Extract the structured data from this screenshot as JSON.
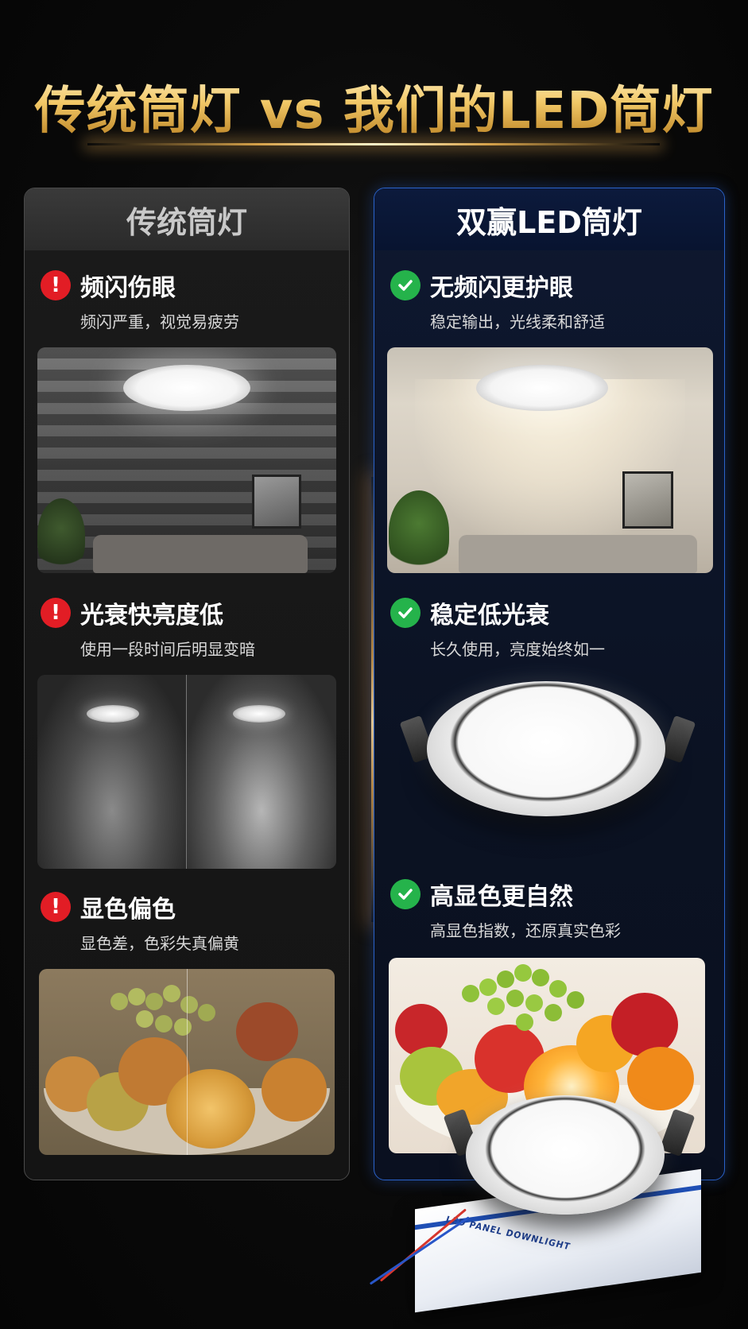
{
  "header": {
    "title": "传统筒灯 vs 我们的LED筒灯"
  },
  "left_panel": {
    "heading": "传统筒灯",
    "features": [
      {
        "icon": "warning-icon",
        "title": "频闪伤眼",
        "subtitle": "频闪严重，视觉易疲劳"
      },
      {
        "icon": "warning-icon",
        "title": "光衰快亮度低",
        "subtitle": "使用一段时间后明显变暗"
      },
      {
        "icon": "warning-icon",
        "title": "显色偏色",
        "subtitle": "显色差，色彩失真偏黄"
      }
    ]
  },
  "right_panel": {
    "heading": "双赢LED筒灯",
    "features": [
      {
        "icon": "check-icon",
        "title": "无频闪更护眼",
        "subtitle": "稳定输出，光线柔和舒适"
      },
      {
        "icon": "check-icon",
        "title": "稳定低光衰",
        "subtitle": "长久使用，亮度始终如一"
      },
      {
        "icon": "check-icon",
        "title": "高显色更自然",
        "subtitle": "高显色指数，还原真实色彩"
      }
    ]
  },
  "product_box": {
    "label": "LED PANEL DOWNLIGHT"
  },
  "colors": {
    "gold": "#f1c766",
    "warning": "#e21d25",
    "success": "#25b34b",
    "brand_blue": "#2a62c9"
  }
}
